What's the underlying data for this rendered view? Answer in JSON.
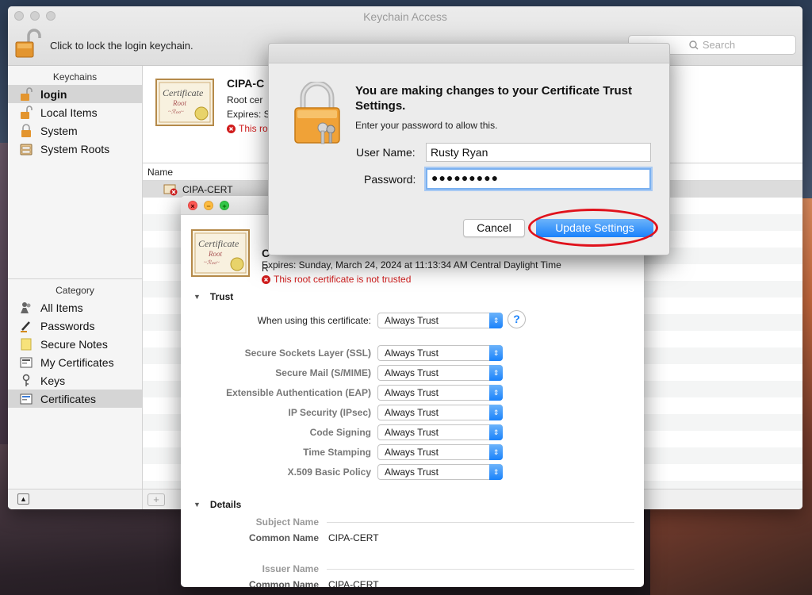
{
  "app": {
    "title": "Keychain Access"
  },
  "toolbar": {
    "lock_text": "Click to lock the login keychain.",
    "search_placeholder": "Search"
  },
  "sidebar": {
    "keychains_header": "Keychains",
    "keychains": [
      {
        "label": "login",
        "icon": "unlocked-padlock-icon"
      },
      {
        "label": "Local Items",
        "icon": "unlocked-padlock-icon"
      },
      {
        "label": "System",
        "icon": "locked-padlock-icon"
      },
      {
        "label": "System Roots",
        "icon": "cabinet-icon"
      }
    ],
    "category_header": "Category",
    "categories": [
      {
        "label": "All Items",
        "icon": "people-icon"
      },
      {
        "label": "Passwords",
        "icon": "pencil-icon"
      },
      {
        "label": "Secure Notes",
        "icon": "note-icon"
      },
      {
        "label": "My Certificates",
        "icon": "certificate-icon"
      },
      {
        "label": "Keys",
        "icon": "key-icon"
      },
      {
        "label": "Certificates",
        "icon": "certificate-icon"
      }
    ]
  },
  "summary": {
    "name": "CIPA-C",
    "line1": "Root cer",
    "line2": "Expires: S",
    "line3": "This roo"
  },
  "list": {
    "column_name": "Name",
    "selected_row": "CIPA-CERT"
  },
  "cert_window": {
    "name_partial": "C",
    "kind_partial": "R",
    "expires": "Expires: Sunday, March 24, 2024 at 11:13:34 AM Central Daylight Time",
    "untrusted": "This root certificate is not trusted",
    "trust_section": "Trust",
    "when_using_label": "When using this certificate:",
    "when_using_value": "Always Trust",
    "policies": [
      {
        "label": "Secure Sockets Layer (SSL)",
        "value": "Always Trust"
      },
      {
        "label": "Secure Mail (S/MIME)",
        "value": "Always Trust"
      },
      {
        "label": "Extensible Authentication (EAP)",
        "value": "Always Trust"
      },
      {
        "label": "IP Security (IPsec)",
        "value": "Always Trust"
      },
      {
        "label": "Code Signing",
        "value": "Always Trust"
      },
      {
        "label": "Time Stamping",
        "value": "Always Trust"
      },
      {
        "label": "X.509 Basic Policy",
        "value": "Always Trust"
      }
    ],
    "details_section": "Details",
    "subject_name": "Subject Name",
    "common_name_label": "Common Name",
    "common_name_value": "CIPA-CERT",
    "issuer_name": "Issuer Name",
    "issuer_common_name_label": "Common Name",
    "issuer_common_name_value": "CIPA-CERT"
  },
  "auth": {
    "title": "You are making changes to your Certificate Trust Settings.",
    "subtitle": "Enter your password to allow this.",
    "user_label": "User Name:",
    "user_value": "Rusty Ryan",
    "password_label": "Password:",
    "password_value": "●●●●●●●●●",
    "cancel": "Cancel",
    "update": "Update Settings"
  },
  "cert_icon": {
    "line1": "Certificate",
    "line2": "Root",
    "line3": "~ℛℴℴ~"
  }
}
